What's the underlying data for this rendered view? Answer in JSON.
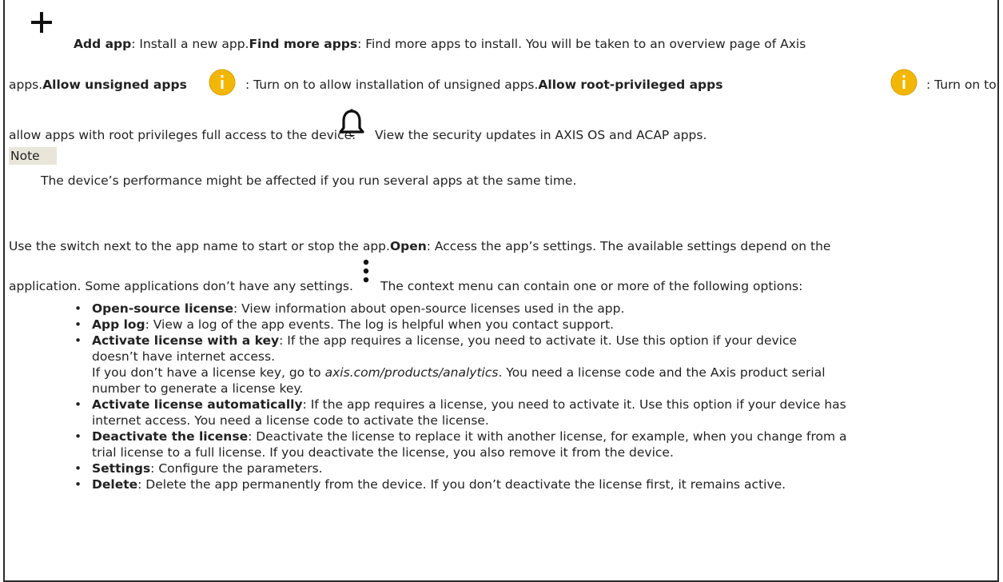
{
  "top": {
    "add_app_label": "Add app",
    "add_app_text": ": Install a new app.",
    "find_more_label": "Find more apps",
    "find_more_text": ": Find more apps to install. You will be taken to an overview page of Axis",
    "line2_start": "apps.",
    "allow_unsigned_label": "Allow unsigned apps",
    "allow_unsigned_text": ": Turn on to allow installation of unsigned apps.",
    "allow_root_label": "Allow root-privileged apps",
    "allow_root_text": ": Turn on to",
    "line3_text": "allow apps with root privileges full access to the device.",
    "security_text": "View the security updates in AXIS OS and ACAP apps."
  },
  "note": {
    "label": "Note",
    "text": "The device’s performance might be affected if you run several apps at the same time."
  },
  "switch_section": {
    "line1_start": "Use the switch next to the app name to start or stop the app.",
    "open_label": "Open",
    "open_text": ": Access the app’s settings. The available settings depend on the",
    "line2_text": "application. Some applications don’t have any settings.",
    "context_text": "The context menu can contain one or more of the following options:"
  },
  "options": [
    {
      "label": "Open-source license",
      "text": ": View information about open-source licenses used in the app."
    },
    {
      "label": "App log",
      "text": ": View a log of the app events. The log is helpful when you contact support."
    },
    {
      "label": "Activate license with a key",
      "text": ": If the app requires a license, you need to activate it. Use this option if your device",
      "text2": "doesn’t have internet access.",
      "sub_pre": "If you don’t have a license key, go to ",
      "sub_link": "axis.com/products/analytics",
      "sub_post": ". You need a license code and the Axis product serial",
      "sub2": "number to generate a license key."
    },
    {
      "label": "Activate license automatically",
      "text": ": If the app requires a license, you need to activate it. Use this option if your device has",
      "text2": "internet access. You need a license code to activate the license."
    },
    {
      "label": "Deactivate the license",
      "text": ": Deactivate the license to replace it with another license, for example, when you change from a",
      "text2": "trial license to a full license. If you deactivate the license, you also remove it from the device."
    },
    {
      "label": "Settings",
      "text": ": Configure the parameters."
    },
    {
      "label": "Delete",
      "text": ": Delete the app permanently from the device. If you don’t deactivate the license first, it remains active."
    }
  ],
  "colors": {
    "info_icon": "#f2b705",
    "note_bg": "#e9e6d9",
    "border": "#2b2b2b"
  },
  "icons": [
    "plus-icon",
    "info-icon",
    "bell-icon",
    "kebab-icon"
  ]
}
